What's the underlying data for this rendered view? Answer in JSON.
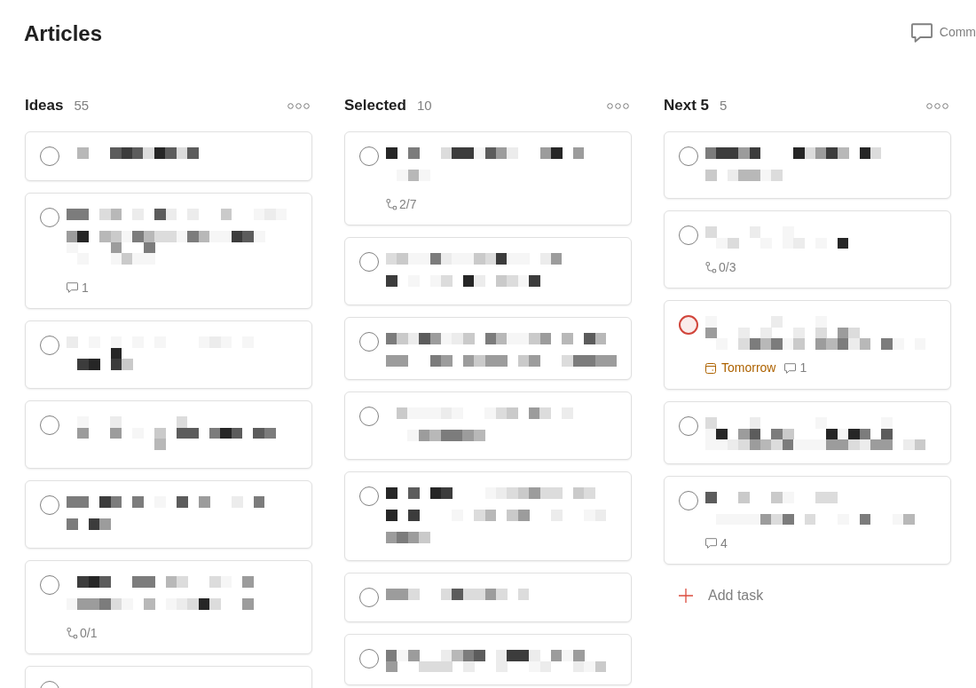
{
  "page": {
    "title": "Articles",
    "comments_button": {
      "label": "Comm"
    }
  },
  "columns": [
    {
      "name": "Ideas",
      "count": "55",
      "cards": [
        {
          "color": "#808080"
        },
        {
          "color": "#808080",
          "comments": "1"
        },
        {
          "color": "#808080"
        },
        {
          "color": "#808080"
        },
        {
          "color": "#808080"
        },
        {
          "color": "#808080",
          "subtasks": "0/1"
        },
        {
          "color": "#808080"
        }
      ]
    },
    {
      "name": "Selected",
      "count": "10",
      "cards": [
        {
          "color": "#808080",
          "subtasks": "2/7"
        },
        {
          "color": "#808080"
        },
        {
          "color": "#808080"
        },
        {
          "color": "#808080"
        },
        {
          "color": "#808080"
        },
        {
          "color": "#808080"
        },
        {
          "color": "#808080"
        }
      ]
    },
    {
      "name": "Next 5",
      "count": "5",
      "cards": [
        {
          "color": "#808080"
        },
        {
          "color": "#808080",
          "subtasks": "0/3"
        },
        {
          "color": "#d1453b",
          "due": "Tomorrow",
          "comments": "1"
        },
        {
          "color": "#808080"
        },
        {
          "color": "#808080",
          "comments": "4"
        }
      ],
      "add_task": {
        "label": "Add task"
      }
    }
  ]
}
